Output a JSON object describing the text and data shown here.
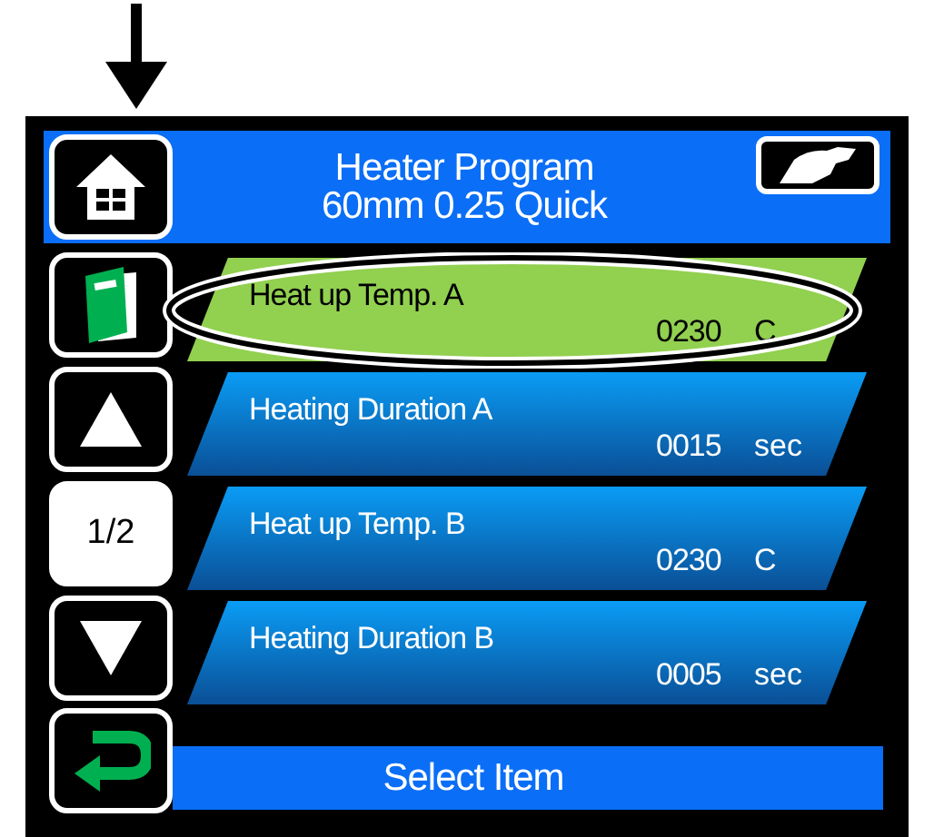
{
  "header": {
    "title": "Heater Program",
    "subtitle": "60mm 0.25 Quick"
  },
  "sidebar": {
    "page": "1/2"
  },
  "items": [
    {
      "label": "Heat up Temp. A",
      "value": "0230",
      "unit": "C",
      "selected": true
    },
    {
      "label": "Heating Duration A",
      "value": "0015",
      "unit": "sec",
      "selected": false
    },
    {
      "label": "Heat up Temp. B",
      "value": "0230",
      "unit": "C",
      "selected": false
    },
    {
      "label": "Heating Duration B",
      "value": "0005",
      "unit": "sec",
      "selected": false
    }
  ],
  "status_bar": {
    "text": "Select Item"
  }
}
